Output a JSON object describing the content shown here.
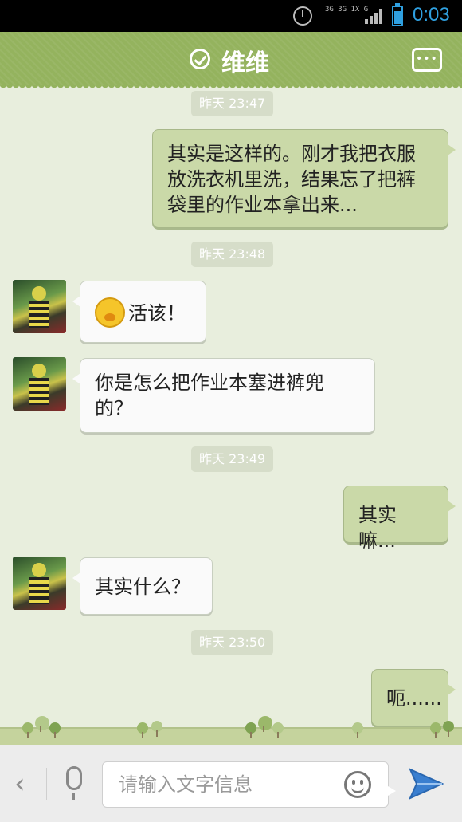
{
  "status_bar": {
    "network": "3G 3G 1X G",
    "time": "0:03"
  },
  "header": {
    "title": "维维"
  },
  "messages": [
    {
      "time": "昨天 23:47"
    },
    {
      "text": "其实是这样的。刚才我把衣服放洗衣机里洗，结果忘了把裤袋里的作业本拿出来..."
    },
    {
      "time": "昨天 23:48"
    },
    {
      "text": "活该！",
      "emoji": "embarrassed-smiley-emoji"
    },
    {
      "text": "你是怎么把作业本塞进裤兜的？"
    },
    {
      "time": "昨天 23:49"
    },
    {
      "text": "其实嘛..."
    },
    {
      "text": "其实什么？"
    },
    {
      "time": "昨天 23:50"
    },
    {
      "text": "呃......"
    }
  ],
  "input": {
    "placeholder": "请输入文字信息"
  },
  "colors": {
    "header": "#94b35e",
    "background": "#e8eedd",
    "outgoing_bubble": "#cad9a8",
    "incoming_bubble": "#fafafa",
    "status_accent": "#2fa0e0"
  }
}
